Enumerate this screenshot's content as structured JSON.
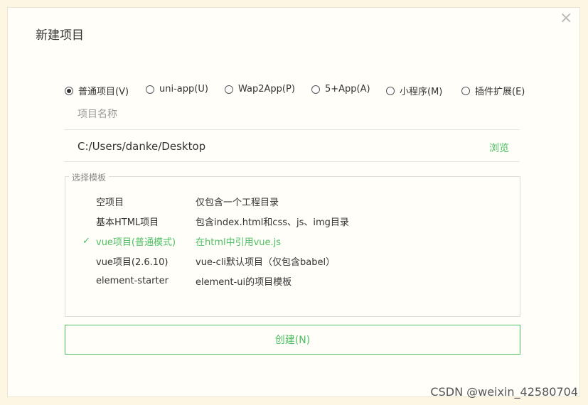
{
  "dialog": {
    "title": "新建项目",
    "close_glyph": "×"
  },
  "project_types": [
    {
      "label": "普通项目(V)",
      "checked": true
    },
    {
      "label": "uni-app(U)",
      "checked": false
    },
    {
      "label": "Wap2App(P)",
      "checked": false
    },
    {
      "label": "5+App(A)",
      "checked": false
    },
    {
      "label": "小程序(M)",
      "checked": false
    },
    {
      "label": "插件扩展(E)",
      "checked": false
    }
  ],
  "name_field": {
    "value": "",
    "placeholder": "项目名称"
  },
  "path_field": {
    "value": "C:/Users/danke/Desktop",
    "browse_label": "浏览"
  },
  "templates": {
    "legend": "选择模板",
    "items": [
      {
        "name": "空项目",
        "desc": "仅包含一个工程目录",
        "selected": false
      },
      {
        "name": "基本HTML项目",
        "desc": "包含index.html和css、js、img目录",
        "selected": false
      },
      {
        "name": "vue项目(普通模式)",
        "desc": "在html中引用vue.js",
        "selected": true
      },
      {
        "name": "vue项目(2.6.10)",
        "desc": "vue-cli默认项目（仅包含babel）",
        "selected": false
      },
      {
        "name": "element-starter",
        "desc": "element-ui的项目模板",
        "selected": false
      }
    ]
  },
  "create_button": {
    "label": "创建(N)"
  },
  "watermark": "CSDN @weixin_42580704",
  "colors": {
    "accent": "#4cbf63",
    "background": "#fdf6e3",
    "dialog": "#fffef8"
  },
  "icons": {
    "close": "close-icon",
    "check": "check-icon"
  }
}
